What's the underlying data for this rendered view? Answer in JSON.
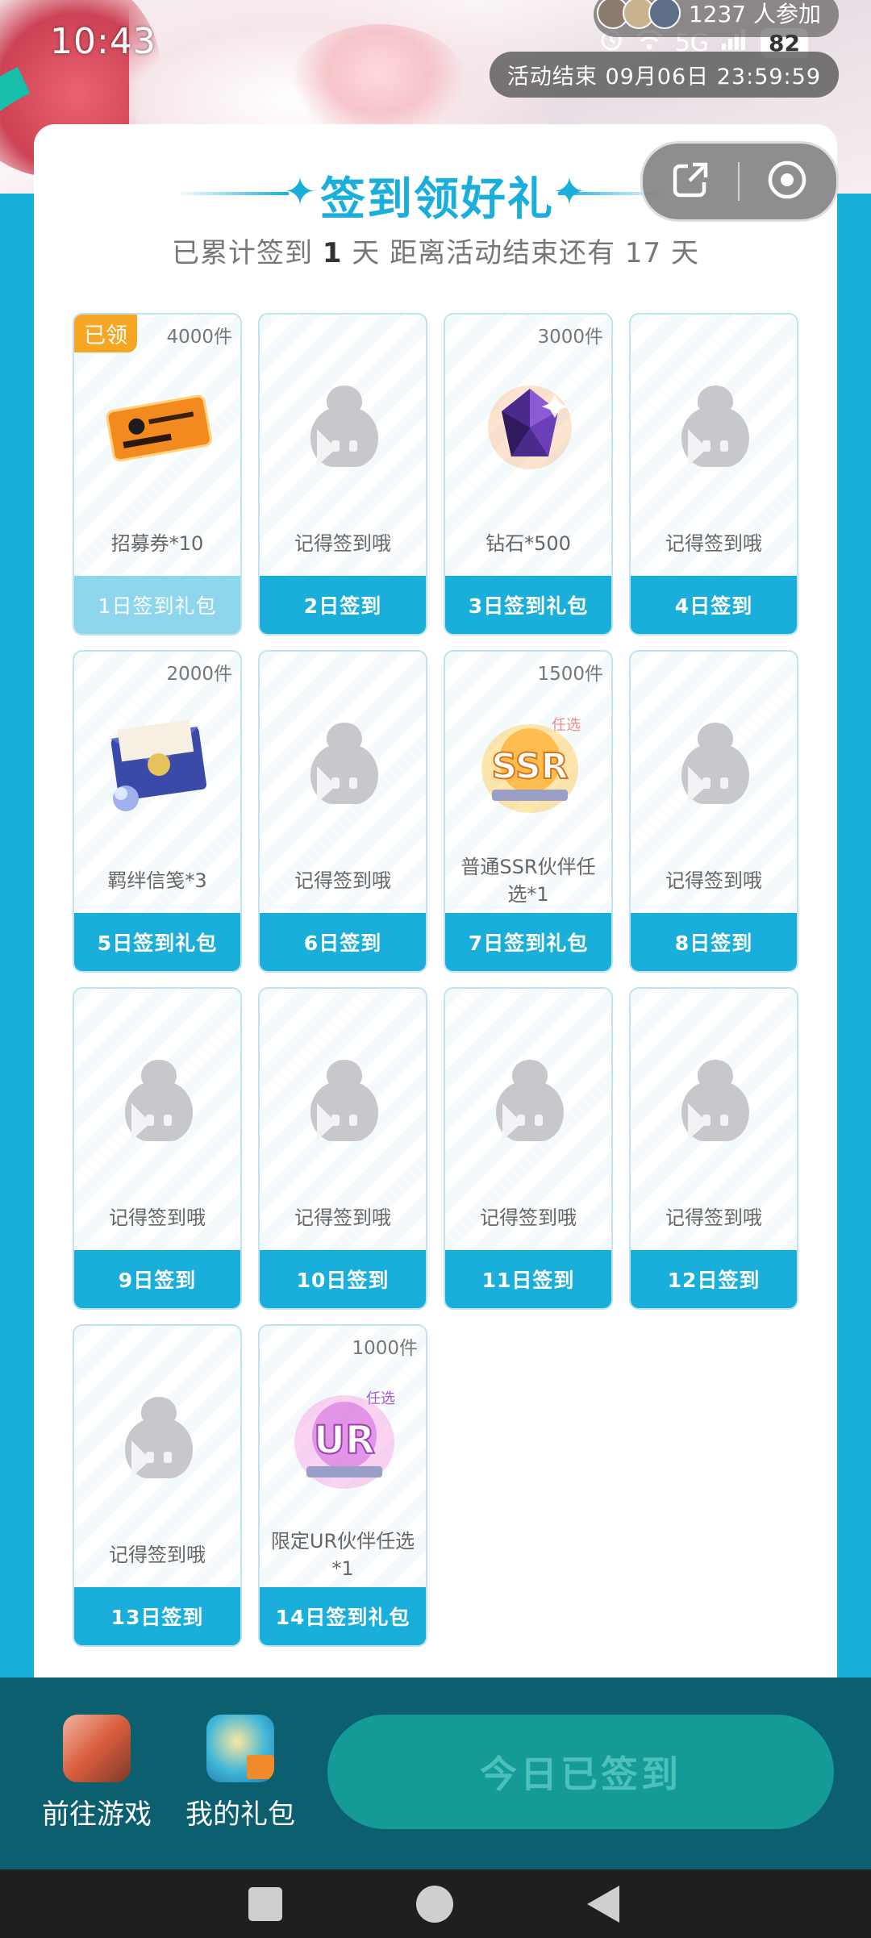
{
  "status_bar": {
    "time": "10:43",
    "network": "5G",
    "battery": "82"
  },
  "banner": {
    "participants": "1237 人参加",
    "end_time": "活动结束 09月06日 23:59:59"
  },
  "header": {
    "title": "签到领好礼",
    "subtitle_prefix": "已累计签到",
    "signed_days": "1",
    "subtitle_middle": "天  距离活动结束还有",
    "days_left": "17",
    "subtitle_suffix": "天"
  },
  "capsule": {
    "share_icon": "share-icon",
    "close_icon": "target-close-icon"
  },
  "days": [
    {
      "day": "1日签到礼包",
      "reward": "招募券*10",
      "count": "4000件",
      "claimed": "已领",
      "art": "ticket",
      "status": "done"
    },
    {
      "day": "2日签到",
      "reward": "记得签到哦",
      "count": "",
      "claimed": "",
      "art": "placeholder",
      "status": "pending"
    },
    {
      "day": "3日签到礼包",
      "reward": "钻石*500",
      "count": "3000件",
      "claimed": "",
      "art": "diamond",
      "status": "pending"
    },
    {
      "day": "4日签到",
      "reward": "记得签到哦",
      "count": "",
      "claimed": "",
      "art": "placeholder",
      "status": "pending"
    },
    {
      "day": "5日签到礼包",
      "reward": "羁绊信笺*3",
      "count": "2000件",
      "claimed": "",
      "art": "letter",
      "status": "pending"
    },
    {
      "day": "6日签到",
      "reward": "记得签到哦",
      "count": "",
      "claimed": "",
      "art": "placeholder",
      "status": "pending"
    },
    {
      "day": "7日签到礼包",
      "reward": "普通SSR伙伴任选*1",
      "count": "1500件",
      "claimed": "",
      "art": "ssr",
      "status": "pending"
    },
    {
      "day": "8日签到",
      "reward": "记得签到哦",
      "count": "",
      "claimed": "",
      "art": "placeholder",
      "status": "pending"
    },
    {
      "day": "9日签到",
      "reward": "记得签到哦",
      "count": "",
      "claimed": "",
      "art": "placeholder",
      "status": "pending"
    },
    {
      "day": "10日签到",
      "reward": "记得签到哦",
      "count": "",
      "claimed": "",
      "art": "placeholder",
      "status": "pending"
    },
    {
      "day": "11日签到",
      "reward": "记得签到哦",
      "count": "",
      "claimed": "",
      "art": "placeholder",
      "status": "pending"
    },
    {
      "day": "12日签到",
      "reward": "记得签到哦",
      "count": "",
      "claimed": "",
      "art": "placeholder",
      "status": "pending"
    },
    {
      "day": "13日签到",
      "reward": "记得签到哦",
      "count": "",
      "claimed": "",
      "art": "placeholder",
      "status": "pending"
    },
    {
      "day": "14日签到礼包",
      "reward": "限定UR伙伴任选*1",
      "count": "1000件",
      "claimed": "",
      "art": "ur",
      "status": "pending"
    }
  ],
  "bottom": {
    "go_game": "前往游戏",
    "my_gifts": "我的礼包",
    "signed_button": "今日已签到"
  },
  "colors": {
    "accent": "#1aaedb",
    "claimed_badge": "#f6a623",
    "bottom_bar": "#0b5f6e",
    "signed_button": "#149b98"
  }
}
